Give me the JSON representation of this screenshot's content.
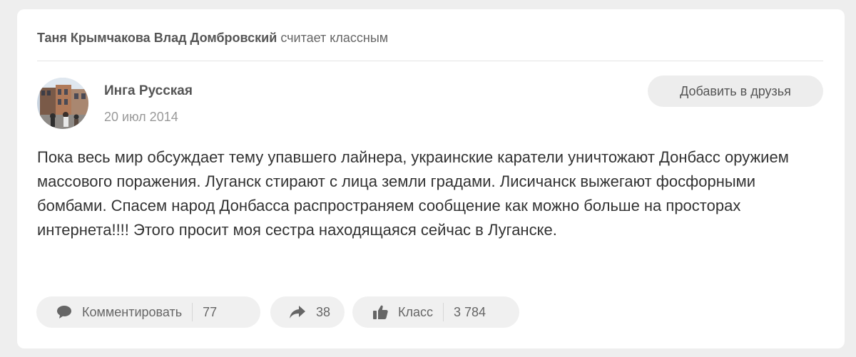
{
  "activity": {
    "actor1": "Таня Крымчакова",
    "actor2": "Влад Домбровский",
    "action_text": "считает классным"
  },
  "post": {
    "author": "Инга Русская",
    "date": "20 июл 2014",
    "add_friend_label": "Добавить в друзья",
    "text": "Пока весь мир обсуждает тему упавшего лайнера, украинские каратели уничтожают Донбасс оружием массового поражения. Луганск стирают с лица земли градами. Лисичанск выжегают фосфорными бомбами. Спасем народ Донбасса распространяем сообщение как можно больше на просторах интернета!!!! Этого просит моя сестра находящаяся сейчас в Луганске."
  },
  "actions": {
    "comment_label": "Комментировать",
    "comment_count": "77",
    "share_count": "38",
    "like_label": "Класс",
    "like_count": "3 784"
  },
  "icons": {
    "comment": "speech-bubble-icon",
    "share": "share-arrow-icon",
    "like": "thumbs-up-icon"
  },
  "colors": {
    "background": "#eeeeee",
    "card": "#ffffff",
    "button": "#f0f0f0",
    "text": "#333333",
    "muted": "#999999"
  }
}
